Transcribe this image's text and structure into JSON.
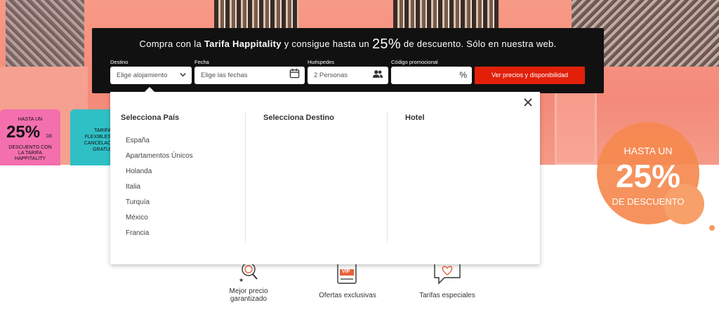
{
  "promo": {
    "part1": "Compra con la ",
    "brand": "Tarifa Happitality",
    "part2": " y consigue hasta un ",
    "percent": "25%",
    "part3": " de descuento. Sólo en nuestra web."
  },
  "search": {
    "destino_label": "Destino",
    "destino_value": "Elige alojamiento",
    "fecha_label": "Fecha",
    "fecha_value": "Elige las fechas",
    "huespedes_label": "Huéspedes",
    "huespedes_value": "2 Personas",
    "codigo_label": "Código promocional",
    "codigo_value": "",
    "codigo_symbol": "%",
    "cta_label": "Ver precios y disponibilidad"
  },
  "dropdown": {
    "col1_title": "Selecciona País",
    "col2_title": "Selecciona Destino",
    "col3_title": "Hotel",
    "countries": [
      "España",
      "Apartamentos Únicos",
      "Holanda",
      "Italia",
      "Turquía",
      "México",
      "Francia"
    ]
  },
  "badge_pink": {
    "line1": "HASTA UN",
    "percent": "25%",
    "de": "DE",
    "line3a": "DESCUENTO CON",
    "line3b": "LA TARIFA",
    "line3c": "HAPPITALITY"
  },
  "badge_teal": {
    "line1": "TARIFA",
    "line2": "FLEXIBLES",
    "line3": "CANCELAC",
    "line4": "GRATUI"
  },
  "discount_circle": {
    "line1": "HASTA UN",
    "percent": "25%",
    "line3": "DE DESCUENTO"
  },
  "features": {
    "f1_line1": "Mejor precio",
    "f1_line2": "garantizado",
    "f2": "Ofertas exclusivas",
    "f3": "Tarifas especiales",
    "vip": "VIP"
  },
  "colors": {
    "cta": "#e2200a",
    "bar": "#111111",
    "pink_badge": "#f36fae",
    "teal_badge": "#2fc0c6",
    "circle": "#f5894f"
  }
}
